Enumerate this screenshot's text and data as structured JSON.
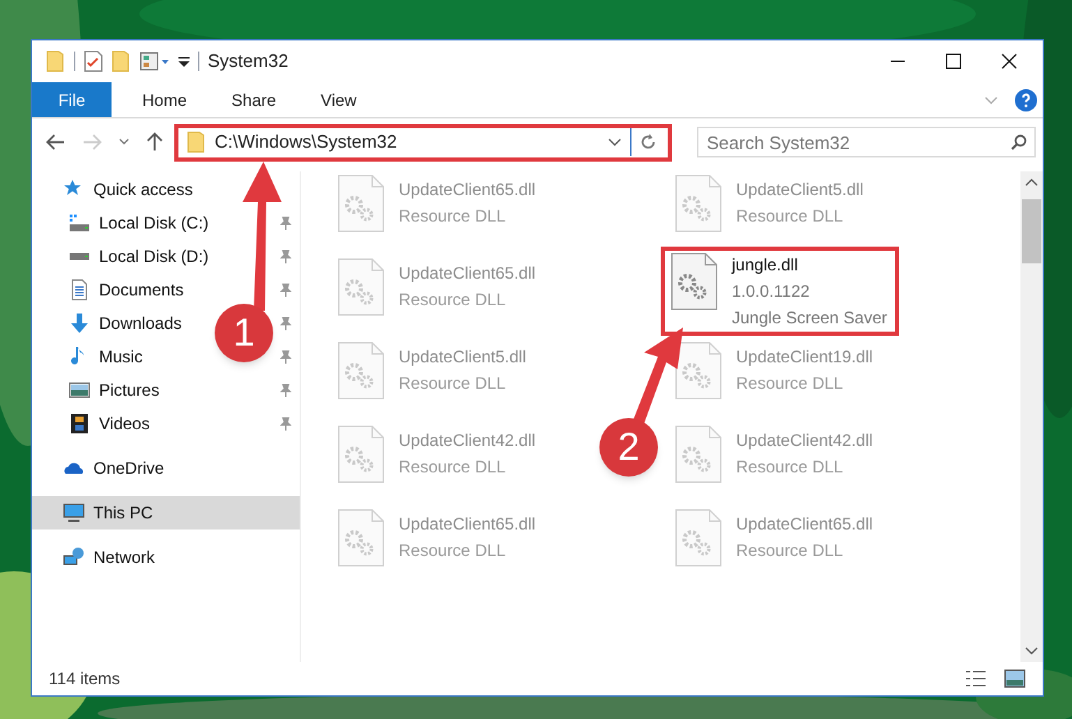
{
  "window": {
    "title": "System32"
  },
  "ribbon_tabs": [
    {
      "label": "File",
      "selected": true
    },
    {
      "label": "Home",
      "selected": false
    },
    {
      "label": "Share",
      "selected": false
    },
    {
      "label": "View",
      "selected": false
    }
  ],
  "address": {
    "path": "C:\\Windows\\System32"
  },
  "search": {
    "placeholder": "Search System32"
  },
  "sidebar": {
    "items": [
      {
        "label": "Quick access",
        "selected": false,
        "pinned": false,
        "children": [
          {
            "label": "Local Disk (C:)",
            "selected": false,
            "pinned": true
          },
          {
            "label": "Local Disk (D:)",
            "selected": false,
            "pinned": true
          },
          {
            "label": "Documents",
            "selected": false,
            "pinned": true
          },
          {
            "label": "Downloads",
            "selected": false,
            "pinned": true
          },
          {
            "label": "Music",
            "selected": false,
            "pinned": true
          },
          {
            "label": "Pictures",
            "selected": false,
            "pinned": true
          },
          {
            "label": "Videos",
            "selected": false,
            "pinned": true
          }
        ]
      },
      {
        "label": "OneDrive",
        "selected": false,
        "pinned": false
      },
      {
        "label": "This PC",
        "selected": true,
        "pinned": false
      },
      {
        "label": "Network",
        "selected": false,
        "pinned": false
      }
    ]
  },
  "files": [
    {
      "name": "UpdateClient65.dll",
      "lines": [
        "Resource DLL"
      ],
      "blurred": true,
      "highlighted": false
    },
    {
      "name": "UpdateClient5.dll",
      "lines": [
        "Resource DLL"
      ],
      "blurred": true,
      "highlighted": false
    },
    {
      "name": "UpdateClient65.dll",
      "lines": [
        "Resource DLL"
      ],
      "blurred": true,
      "highlighted": false
    },
    {
      "name": "jungle.dll",
      "lines": [
        "1.0.0.1122",
        "Jungle Screen Saver"
      ],
      "blurred": false,
      "highlighted": true
    },
    {
      "name": "UpdateClient5.dll",
      "lines": [
        "Resource DLL"
      ],
      "blurred": true,
      "highlighted": false
    },
    {
      "name": "UpdateClient19.dll",
      "lines": [
        "Resource DLL"
      ],
      "blurred": true,
      "highlighted": false
    },
    {
      "name": "UpdateClient42.dll",
      "lines": [
        "Resource DLL"
      ],
      "blurred": true,
      "highlighted": false
    },
    {
      "name": "UpdateClient42.dll",
      "lines": [
        "Resource DLL"
      ],
      "blurred": true,
      "highlighted": false
    },
    {
      "name": "UpdateClient65.dll",
      "lines": [
        "Resource DLL"
      ],
      "blurred": true,
      "highlighted": false
    },
    {
      "name": "UpdateClient65.dll",
      "lines": [
        "Resource DLL"
      ],
      "blurred": true,
      "highlighted": false
    }
  ],
  "status_bar": {
    "count": "114 items"
  },
  "annotations": [
    {
      "number": "1"
    },
    {
      "number": "2"
    }
  ]
}
